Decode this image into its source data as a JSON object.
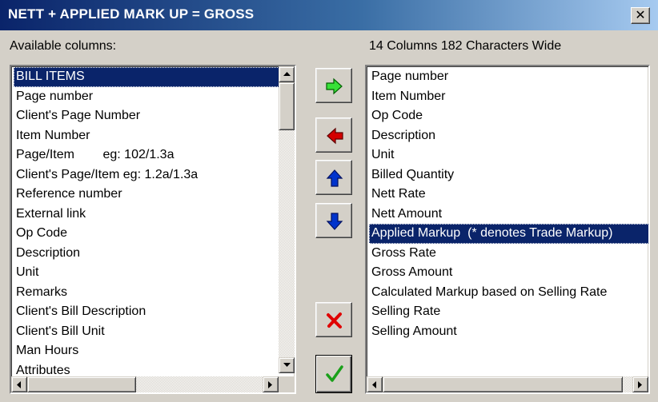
{
  "window": {
    "title": "NETT + APPLIED MARK UP = GROSS",
    "close_glyph": "✕"
  },
  "available": {
    "label": "Available columns:",
    "items": [
      "BILL ITEMS",
      "Page number",
      "Client's Page Number",
      "Item Number",
      "Page/Item        eg: 102/1.3a",
      "Client's Page/Item eg: 1.2a/1.3a",
      "Reference number",
      "External link",
      "Op Code",
      "Description",
      "Unit",
      "Remarks",
      "Client's Bill Description",
      "Client's Bill Unit",
      "Man Hours",
      "Attributes"
    ],
    "selected_index": 0
  },
  "selected_columns": {
    "label": "14 Columns 182 Characters Wide",
    "items": [
      "Page number",
      "Item Number",
      "Op Code",
      "Description",
      "Unit",
      "Billed Quantity",
      "Nett Rate",
      "Nett Amount",
      "Applied Markup  (* denotes Trade Markup)",
      "Gross Rate",
      "Gross Amount",
      "Calculated Markup based on Selling Rate",
      "Selling Rate",
      "Selling Amount"
    ],
    "selected_index": 8
  },
  "buttons": {
    "add": {
      "icon": "green-right-arrow-icon",
      "color": "#2ecc2e"
    },
    "remove": {
      "icon": "red-left-arrow-icon",
      "color": "#d40000"
    },
    "move_up": {
      "icon": "blue-up-arrow-icon",
      "color": "#0033cc"
    },
    "move_down": {
      "icon": "blue-down-arrow-icon",
      "color": "#0033cc"
    },
    "cancel": {
      "icon": "red-x-icon",
      "color": "#e00000"
    },
    "ok": {
      "icon": "green-check-icon",
      "color": "#1aa01a"
    }
  },
  "colors": {
    "title_bar_start": "#0a246a",
    "title_bar_end": "#a6caf0",
    "selection": "#0a246a",
    "face": "#d4d0c8"
  }
}
